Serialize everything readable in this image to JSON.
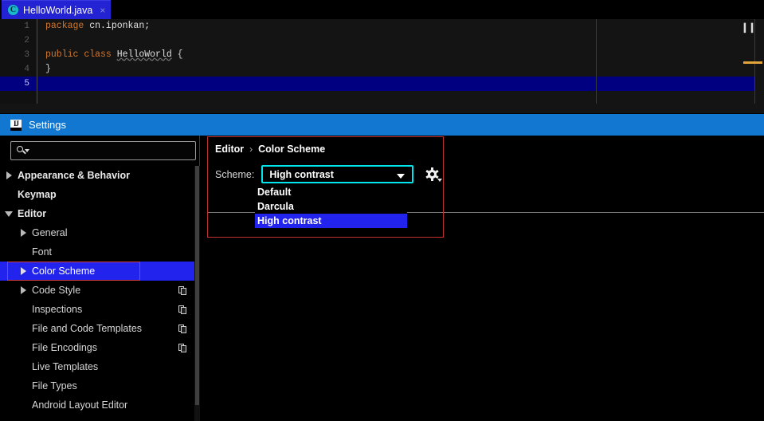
{
  "editor": {
    "tab": {
      "filename": "HelloWorld.java",
      "icon": "java-class-icon",
      "icon_letter": "C",
      "close": "×"
    },
    "gutter_lines": [
      "1",
      "2",
      "3",
      "4",
      "5"
    ],
    "current_line": 5,
    "marker_icon": "pause-icon",
    "marker_glyph": "❙❙",
    "code": [
      {
        "tokens": [
          {
            "t": "package",
            "c": "kw"
          },
          {
            "t": " cn.iponkan;",
            "c": "pkg"
          }
        ]
      },
      {
        "tokens": []
      },
      {
        "tokens": [
          {
            "t": "public",
            "c": "kw"
          },
          {
            "t": " ",
            "c": "punc"
          },
          {
            "t": "class",
            "c": "kw"
          },
          {
            "t": " ",
            "c": "punc"
          },
          {
            "t": "HelloWorld",
            "c": "cls"
          },
          {
            "t": " {",
            "c": "punc"
          }
        ]
      },
      {
        "tokens": [
          {
            "t": "}",
            "c": "punc"
          }
        ]
      },
      {
        "tokens": []
      }
    ]
  },
  "settings": {
    "title": "Settings",
    "logo": "intellij-idea-logo",
    "search": {
      "value": "",
      "placeholder": ""
    },
    "tree": [
      {
        "label": "Appearance & Behavior",
        "twisty": "right",
        "level": 0,
        "bold": true,
        "badge": false,
        "selected": false
      },
      {
        "label": "Keymap",
        "twisty": "none",
        "level": 0,
        "bold": true,
        "badge": false,
        "selected": false
      },
      {
        "label": "Editor",
        "twisty": "down",
        "level": 0,
        "bold": true,
        "badge": false,
        "selected": false
      },
      {
        "label": "General",
        "twisty": "right",
        "level": 1,
        "bold": false,
        "badge": false,
        "selected": false
      },
      {
        "label": "Font",
        "twisty": "none",
        "level": 1,
        "bold": false,
        "badge": false,
        "selected": false
      },
      {
        "label": "Color Scheme",
        "twisty": "right",
        "level": 1,
        "bold": false,
        "badge": false,
        "selected": true
      },
      {
        "label": "Code Style",
        "twisty": "right",
        "level": 1,
        "bold": false,
        "badge": true,
        "selected": false
      },
      {
        "label": "Inspections",
        "twisty": "none",
        "level": 1,
        "bold": false,
        "badge": true,
        "selected": false
      },
      {
        "label": "File and Code Templates",
        "twisty": "none",
        "level": 1,
        "bold": false,
        "badge": true,
        "selected": false
      },
      {
        "label": "File Encodings",
        "twisty": "none",
        "level": 1,
        "bold": false,
        "badge": true,
        "selected": false
      },
      {
        "label": "Live Templates",
        "twisty": "none",
        "level": 1,
        "bold": false,
        "badge": false,
        "selected": false
      },
      {
        "label": "File Types",
        "twisty": "none",
        "level": 1,
        "bold": false,
        "badge": false,
        "selected": false
      },
      {
        "label": "Android Layout Editor",
        "twisty": "none",
        "level": 1,
        "bold": false,
        "badge": false,
        "selected": false
      }
    ],
    "content": {
      "breadcrumb": {
        "root": "Editor",
        "separator": "›",
        "leaf": "Color Scheme"
      },
      "scheme_label": "Scheme:",
      "scheme_value": "High contrast",
      "gear_icon": "gear-icon",
      "dropdown_options": [
        {
          "label": "Default",
          "highlighted": false
        },
        {
          "label": "Darcula",
          "highlighted": false
        },
        {
          "label": "High contrast",
          "highlighted": true
        }
      ]
    }
  },
  "colors": {
    "accent_blue": "#2323ee",
    "titlebar_blue": "#1177d1",
    "combo_focus": "#00e5ee",
    "annotation_red": "#c03030",
    "keyword_orange": "#d2762b",
    "current_line": "#000080",
    "warning_marker": "#e2a33a"
  }
}
